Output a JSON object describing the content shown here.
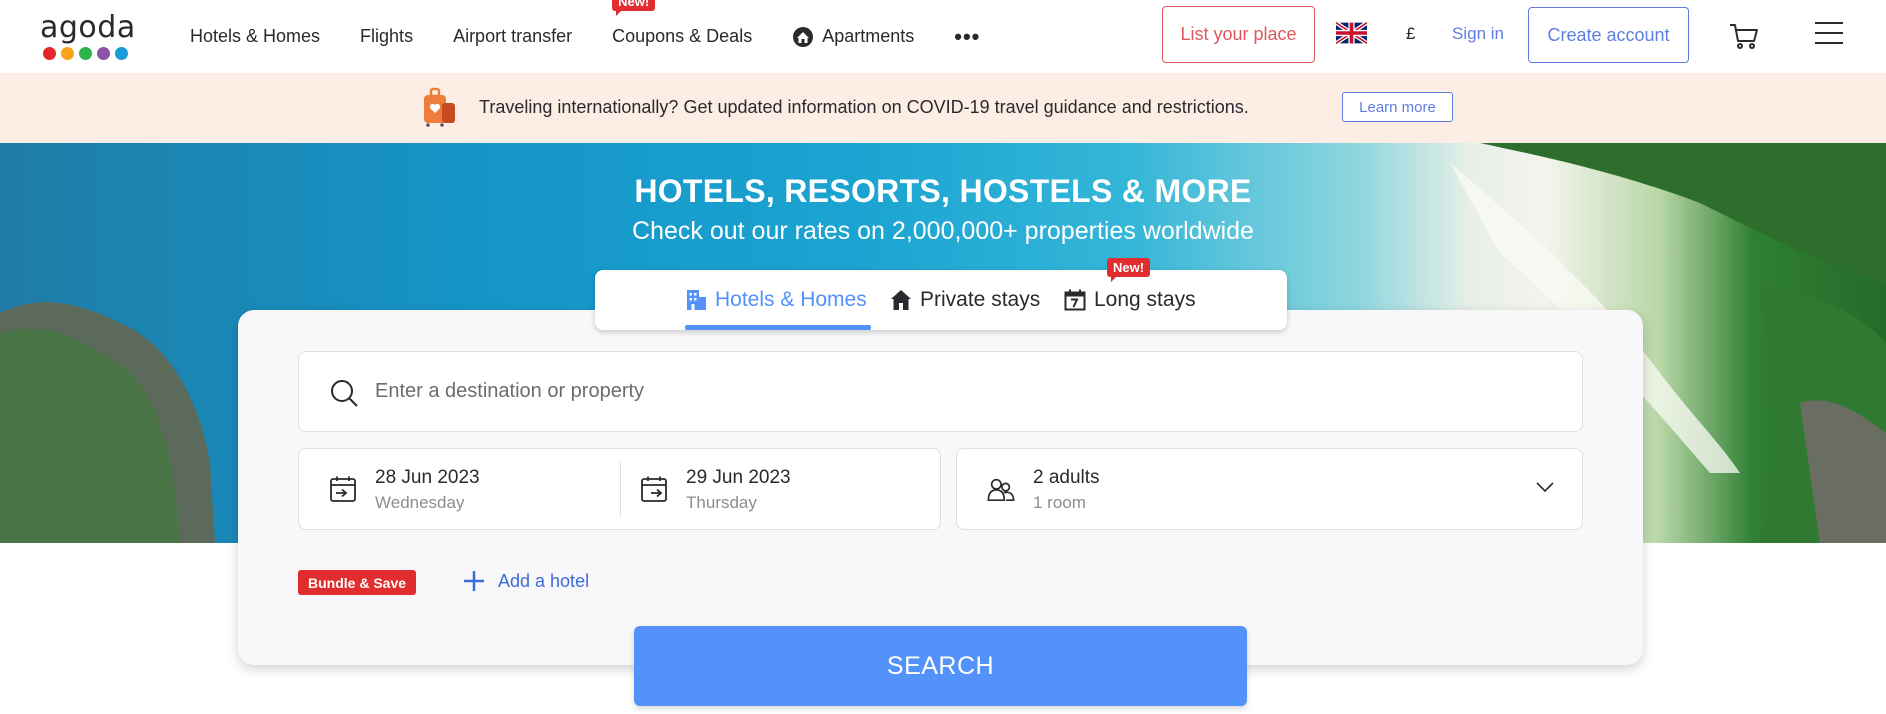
{
  "brand": {
    "logo_text": "agoda",
    "dot_colors": [
      "#e5262c",
      "#f9a21c",
      "#2db34a",
      "#8c52a5",
      "#1a9bd7"
    ]
  },
  "nav": {
    "items": [
      {
        "label": "Hotels & Homes"
      },
      {
        "label": "Flights"
      },
      {
        "label": "Airport transfer"
      },
      {
        "label": "Coupons & Deals",
        "badge": "New!"
      },
      {
        "label": "Apartments",
        "icon": "apartment-icon"
      }
    ],
    "more_label": "•••"
  },
  "header": {
    "list_place": "List your place",
    "currency": "£",
    "sign_in": "Sign in",
    "create_account": "Create account"
  },
  "banner": {
    "text": "Traveling internationally? Get updated information on COVID-19 travel guidance and restrictions.",
    "learn_more": "Learn more"
  },
  "hero": {
    "title": "HOTELS, RESORTS, HOSTELS & MORE",
    "subtitle": "Check out our rates on 2,000,000+ properties worldwide"
  },
  "tabs": [
    {
      "label": "Hotels & Homes",
      "active": true
    },
    {
      "label": "Private stays"
    },
    {
      "label": "Long stays",
      "badge": "New!"
    }
  ],
  "search": {
    "placeholder": "Enter a destination or property",
    "check_in": {
      "date": "28 Jun 2023",
      "day": "Wednesday"
    },
    "check_out": {
      "date": "29 Jun 2023",
      "day": "Thursday"
    },
    "guests": {
      "adults": "2 adults",
      "rooms": "1 room"
    },
    "bundle_label": "Bundle & Save",
    "add_hotel": "Add a hotel",
    "button": "SEARCH"
  },
  "colors": {
    "accent": "#5392f9",
    "link": "#5f7de0",
    "alert": "#e12d2d",
    "list_place": "#e0575c",
    "banner_bg": "#fdeee5"
  }
}
